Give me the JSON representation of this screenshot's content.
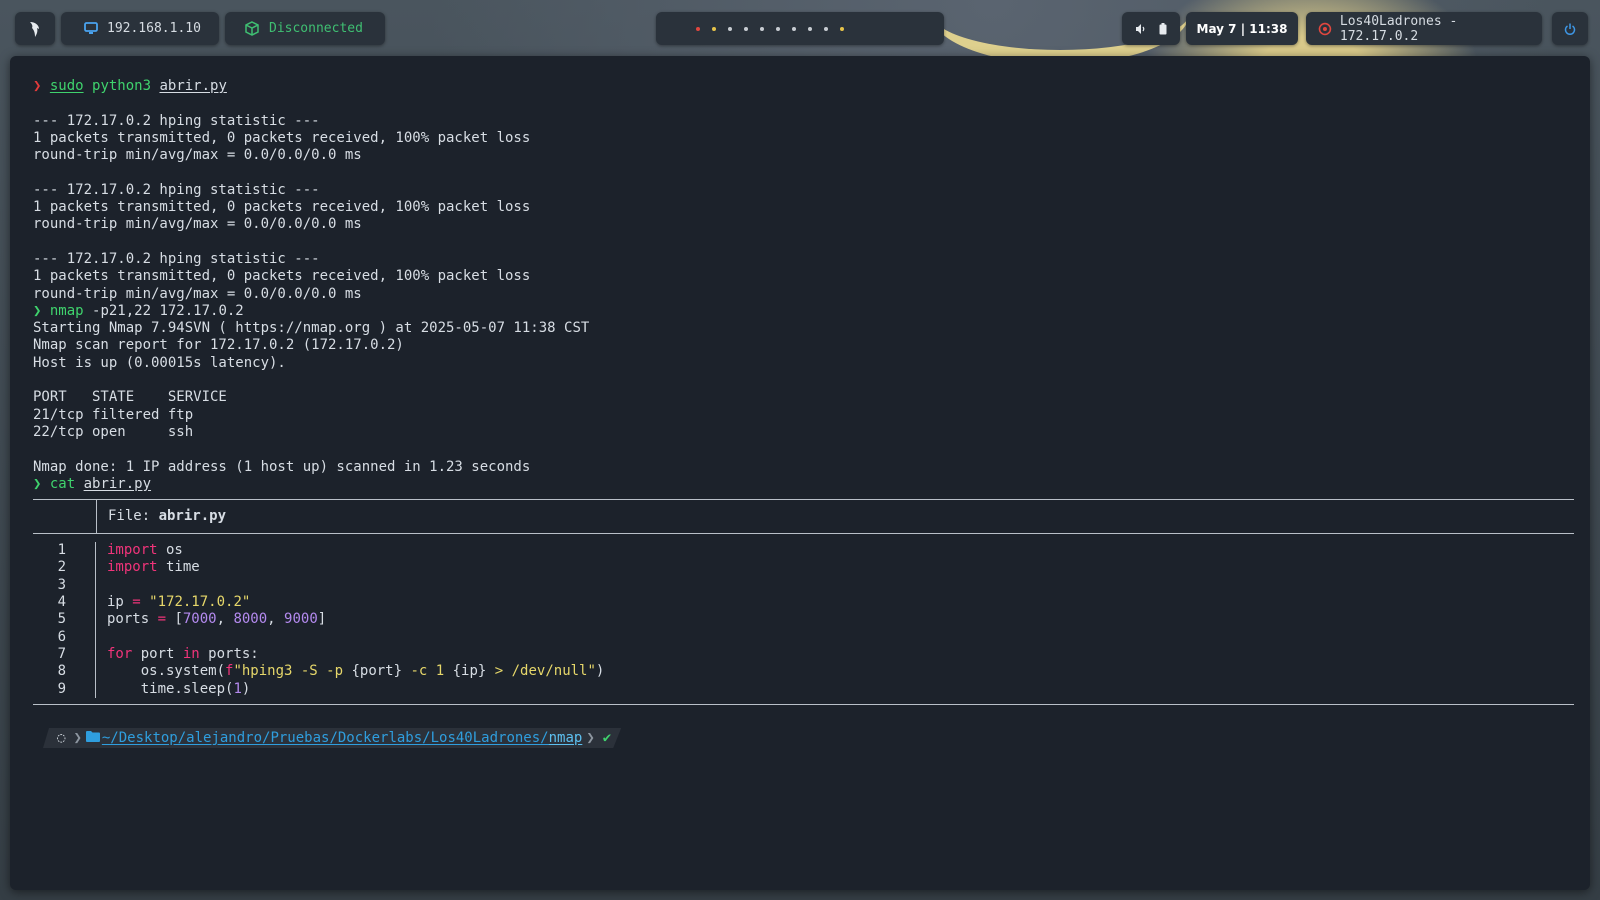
{
  "topbar": {
    "launcher_icon": "kali-dragon-icon",
    "ip_address": "192.168.1.10",
    "vpn_status": "Disconnected",
    "workspace_dots": [
      "#e0473f",
      "#e6c34a",
      "#c7ccd2",
      "#c7ccd2",
      "#c7ccd2",
      "#c7ccd2",
      "#c7ccd2",
      "#c7ccd2",
      "#c7ccd2",
      "#e6c34a"
    ],
    "datetime": "May 7 | 11:38",
    "target": "Los40Ladrones - 172.17.0.2",
    "accent_red": "#e0473f",
    "accent_green": "#3fbf72",
    "accent_blue": "#2f9ede"
  },
  "terminal": {
    "cmd1": {
      "command": "sudo",
      "program": "python3",
      "arg": "abrir.py"
    },
    "hping_blocks": [
      {
        "header": "--- 172.17.0.2 hping statistic ---",
        "stats": "1 packets transmitted, 0 packets received, 100% packet loss",
        "rtt": "round-trip min/avg/max = 0.0/0.0/0.0 ms"
      },
      {
        "header": "--- 172.17.0.2 hping statistic ---",
        "stats": "1 packets transmitted, 0 packets received, 100% packet loss",
        "rtt": "round-trip min/avg/max = 0.0/0.0/0.0 ms"
      },
      {
        "header": "--- 172.17.0.2 hping statistic ---",
        "stats": "1 packets transmitted, 0 packets received, 100% packet loss",
        "rtt": "round-trip min/avg/max = 0.0/0.0/0.0 ms"
      }
    ],
    "cmd2": {
      "command": "nmap",
      "args": "-p21,22 172.17.0.2"
    },
    "nmap_output": [
      "Starting Nmap 7.94SVN ( https://nmap.org ) at 2025-05-07 11:38 CST",
      "Nmap scan report for 172.17.0.2 (172.17.0.2)",
      "Host is up (0.00015s latency).",
      "",
      "PORT   STATE    SERVICE",
      "21/tcp filtered ftp",
      "22/tcp open     ssh",
      "",
      "Nmap done: 1 IP address (1 host up) scanned in 1.23 seconds"
    ],
    "cmd3": {
      "command": "cat",
      "arg": "abrir.py"
    },
    "bat": {
      "file_label": "File: ",
      "file_name": "abrir.py",
      "line_numbers": [
        "1",
        "2",
        "3",
        "4",
        "5",
        "6",
        "7",
        "8",
        "9"
      ],
      "code": {
        "l1_kw": "import",
        "l1_rest": " os",
        "l2_kw": "import",
        "l2_rest": " time",
        "l4_var": "ip ",
        "l4_op": "=",
        "l4_str": " \"172.17.0.2\"",
        "l5_var": "ports ",
        "l5_op": "=",
        "l5_open": " [",
        "l5_n1": "7000",
        "l5_c1": ", ",
        "l5_n2": "8000",
        "l5_c2": ", ",
        "l5_n3": "9000",
        "l5_close": "]",
        "l7_kw": "for",
        "l7_mid": " port ",
        "l7_kw2": "in",
        "l7_rest": " ports:",
        "l8_pre": "    os.system(",
        "l8_f": "f",
        "l8_s1": "\"hping3 -S -p ",
        "l8_b1": "{port}",
        "l8_s2": " -c 1 ",
        "l8_b2": "{ip}",
        "l8_s3": " > /dev/null\"",
        "l8_end": ")",
        "l9_pre": "    time.sleep(",
        "l9_num": "1",
        "l9_end": ")"
      }
    },
    "prompt": {
      "path": "~/Desktop/alejandro/Pruebas/Dockerlabs/Los40Ladrones/",
      "path_end": "nmap",
      "status_icon": "check-icon",
      "status": "✔"
    }
  }
}
